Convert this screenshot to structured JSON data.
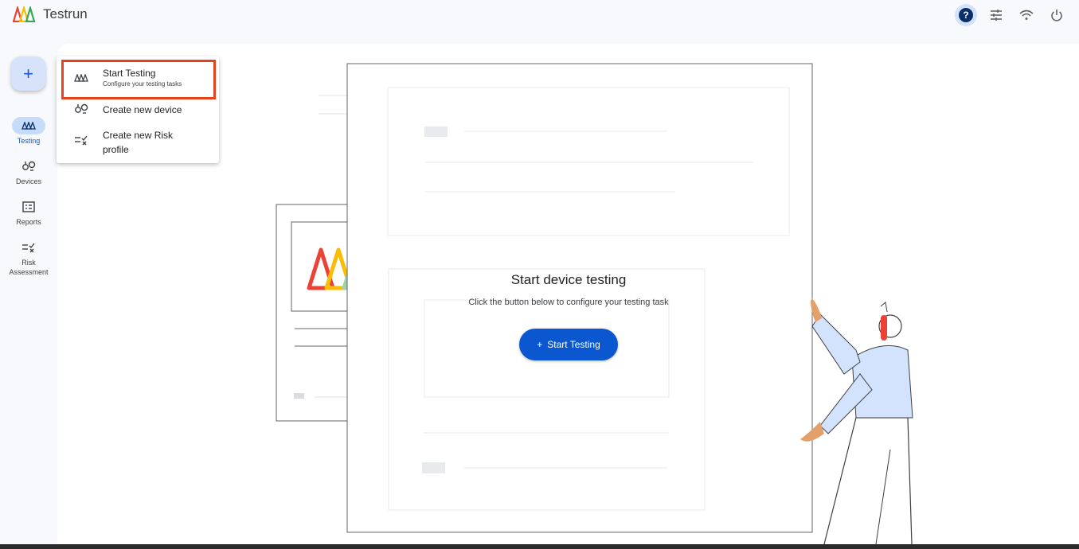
{
  "app": {
    "title": "Testrun"
  },
  "topbar": {
    "icons": [
      "help-icon",
      "settings-sliders-icon",
      "wifi-icon",
      "power-icon"
    ]
  },
  "sidebar": {
    "fab_label": "+",
    "items": [
      {
        "label": "Testing",
        "icon": "testrun-logo-icon",
        "active": true
      },
      {
        "label": "Devices",
        "icon": "devices-icon",
        "active": false
      },
      {
        "label": "Reports",
        "icon": "reports-icon",
        "active": false
      },
      {
        "label": "Risk Assessment",
        "icon": "risk-assessment-icon",
        "active": false
      }
    ]
  },
  "menu": {
    "items": [
      {
        "label": "Start Testing",
        "sublabel": "Configure your testing tasks",
        "icon": "testrun-logo-icon"
      },
      {
        "label": "Create new device",
        "icon": "devices-icon"
      },
      {
        "label": "Create new Risk profile",
        "icon": "risk-assessment-icon"
      }
    ]
  },
  "main": {
    "heading": "Start device testing",
    "subheading": "Click the button below to configure your testing task",
    "button_label": "Start Testing",
    "button_plus": "+"
  },
  "colors": {
    "accent": "#0b57d0",
    "highlight": "#e8421c",
    "fab_bg": "#d7e3fb",
    "active_nav": "#c7dcfb"
  }
}
